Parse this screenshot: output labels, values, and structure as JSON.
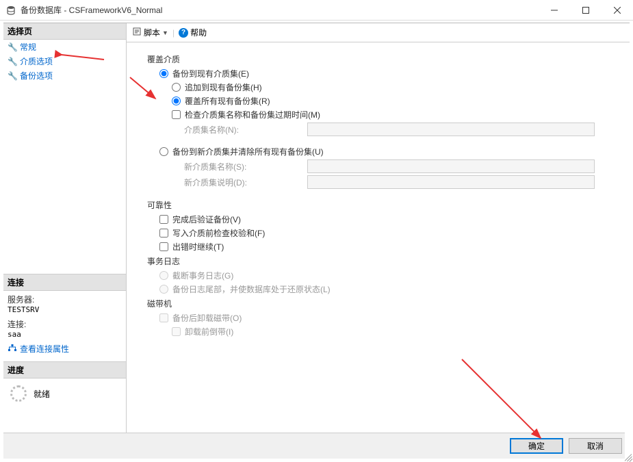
{
  "window": {
    "title": "备份数据库 - CSFrameworkV6_Normal"
  },
  "sidebar": {
    "select_header": "选择页",
    "nav": [
      {
        "label": "常规"
      },
      {
        "label": "介质选项"
      },
      {
        "label": "备份选项"
      }
    ],
    "conn_header": "连接",
    "server_label": "服务器:",
    "server_value": "TESTSRV",
    "conn_label": "连接:",
    "conn_value": "saa",
    "view_props": "查看连接属性",
    "progress_header": "进度",
    "progress_status": "就绪"
  },
  "toolbar": {
    "script": "脚本",
    "help": "帮助"
  },
  "form": {
    "override_group": "覆盖介质",
    "r_existing": "备份到现有介质集(E)",
    "r_append": "追加到现有备份集(H)",
    "r_overwrite": "覆盖所有现有备份集(R)",
    "c_check_media": "检查介质集名称和备份集过期时间(M)",
    "media_name_lbl": "介质集名称(N):",
    "r_newmedia": "备份到新介质集并清除所有现有备份集(U)",
    "new_media_name_lbl": "新介质集名称(S):",
    "new_media_desc_lbl": "新介质集说明(D):",
    "reliab_group": "可靠性",
    "c_verify": "完成后验证备份(V)",
    "c_checksum": "写入介质前检查校验和(F)",
    "c_continue": "出错时继续(T)",
    "txnlog_group": "事务日志",
    "r_truncate": "截断事务日志(G)",
    "r_tail": "备份日志尾部，并使数据库处于还原状态(L)",
    "tape_group": "磁带机",
    "c_unload": "备份后卸载磁带(O)",
    "c_rewind": "卸载前倒带(I)"
  },
  "footer": {
    "ok": "确定",
    "cancel": "取消"
  }
}
